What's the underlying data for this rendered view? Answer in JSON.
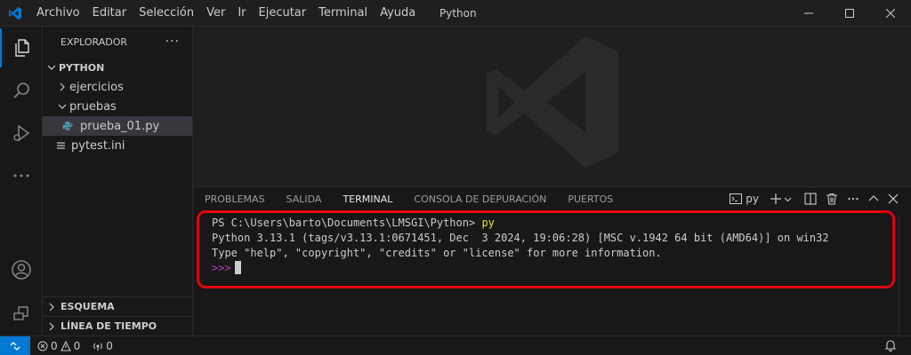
{
  "titlebar": {
    "menu": [
      "Archivo",
      "Editar",
      "Selección",
      "Ver",
      "Ir",
      "Ejecutar",
      "Terminal",
      "Ayuda"
    ],
    "window_title": "Python"
  },
  "sidebar": {
    "header": "EXPLORADOR",
    "more": "···",
    "folder": "PYTHON",
    "items": [
      {
        "label": "ejercicios"
      },
      {
        "label": "pruebas"
      },
      {
        "label": "prueba_01.py"
      },
      {
        "label": "pytest.ini"
      }
    ],
    "sections": [
      "ESQUEMA",
      "LÍNEA DE TIEMPO"
    ]
  },
  "panel": {
    "tabs": [
      "PROBLEMAS",
      "SALIDA",
      "TERMINAL",
      "CONSOLA DE DEPURACIÓN",
      "PUERTOS"
    ],
    "active_tab": "TERMINAL",
    "terminal_profile": "py"
  },
  "terminal": {
    "prompt_path": "PS C:\\Users\\barto\\Documents\\LMSGI\\Python>",
    "command": "py",
    "line2": "Python 3.13.1 (tags/v3.13.1:0671451, Dec  3 2024, 19:06:28) [MSC v.1942 64 bit (AMD64)] on win32",
    "line3": "Type \"help\", \"copyright\", \"credits\" or \"license\" for more information.",
    "repl_prompt": ">>>"
  },
  "statusbar": {
    "errors": "0",
    "warnings": "0",
    "ports": "0"
  },
  "colors": {
    "accent": "#0078d4",
    "highlight_box": "#e3000f",
    "terminal_yellow": "#e5e510",
    "terminal_magenta": "#bc3fbc"
  }
}
